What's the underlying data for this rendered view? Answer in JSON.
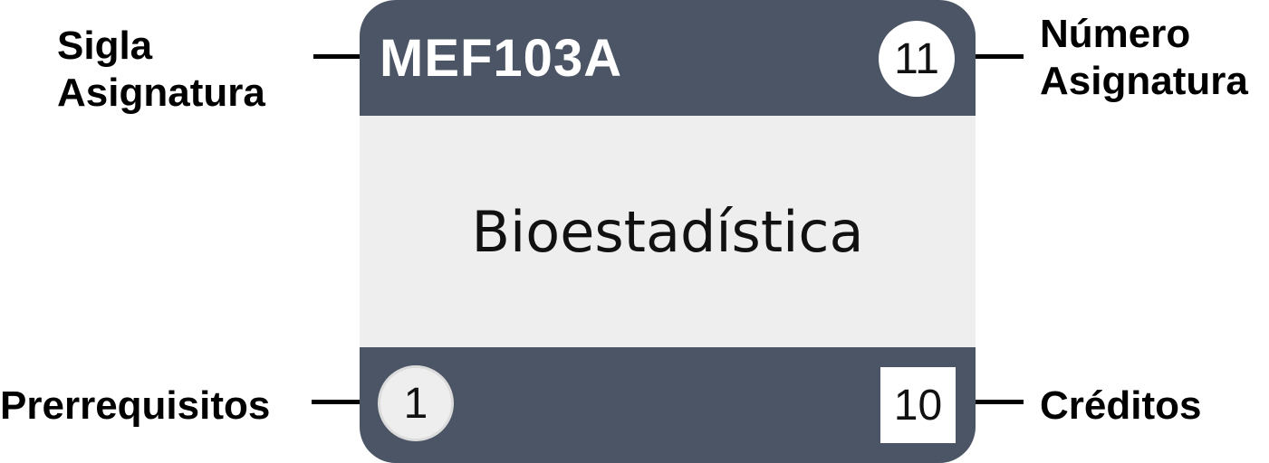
{
  "card": {
    "sigla": "MEF103A",
    "numero": "11",
    "nombre": "Bioestadística",
    "prerrequisitos": "1",
    "creditos": "10"
  },
  "labels": {
    "sigla_line1": "Sigla",
    "sigla_line2": "Asignatura",
    "numero_line1": "Número",
    "numero_line2": "Asignatura",
    "prerrequisitos": "Prerrequisitos",
    "creditos": "Créditos"
  },
  "colors": {
    "header_footer": "#4b5565",
    "body": "#eeeeee",
    "text": "#111111"
  }
}
